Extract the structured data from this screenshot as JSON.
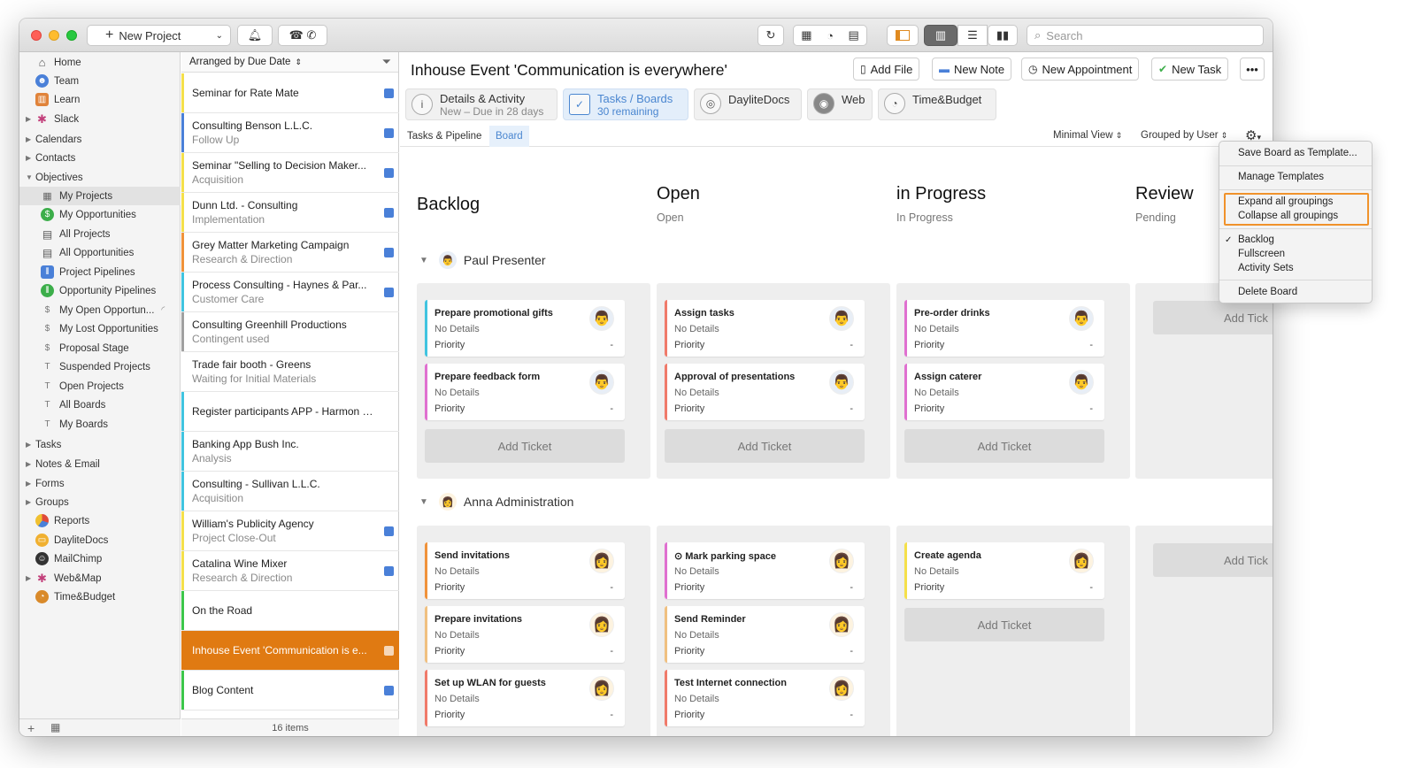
{
  "toolbar": {
    "new_project": "New Project",
    "search_placeholder": "Search"
  },
  "sidebar": {
    "items": [
      {
        "label": "Home",
        "icon": "home-icon"
      },
      {
        "label": "Team",
        "icon": "team-icon"
      },
      {
        "label": "Learn",
        "icon": "learn-icon"
      },
      {
        "label": "Slack",
        "icon": "slack-icon"
      },
      {
        "label": "Calendars"
      },
      {
        "label": "Contacts"
      },
      {
        "label": "Objectives"
      },
      {
        "label": "My Projects"
      },
      {
        "label": "My Opportunities"
      },
      {
        "label": "All Projects"
      },
      {
        "label": "All Opportunities"
      },
      {
        "label": "Project Pipelines"
      },
      {
        "label": "Opportunity Pipelines"
      },
      {
        "label": "My Open Opportun..."
      },
      {
        "label": "My Lost Opportunities"
      },
      {
        "label": "Proposal Stage"
      },
      {
        "label": "Suspended Projects"
      },
      {
        "label": "Open Projects"
      },
      {
        "label": "All Boards"
      },
      {
        "label": "My Boards"
      },
      {
        "label": "Tasks"
      },
      {
        "label": "Notes & Email"
      },
      {
        "label": "Forms"
      },
      {
        "label": "Groups"
      },
      {
        "label": "Reports"
      },
      {
        "label": "DayliteDocs"
      },
      {
        "label": "MailChimp"
      },
      {
        "label": "Web&Map"
      },
      {
        "label": "Time&Budget"
      }
    ]
  },
  "list": {
    "header": "Arranged by Due Date",
    "footer": "16 items",
    "rows": [
      {
        "title": "Seminar for Rate Mate",
        "sub": "",
        "color": "#f5e04a"
      },
      {
        "title": "Consulting Benson L.L.C.",
        "sub": "Follow Up",
        "color": "#4a80d8"
      },
      {
        "title": "Seminar \"Selling to Decision Maker...",
        "sub": "Acquisition",
        "color": "#f5e04a"
      },
      {
        "title": "Dunn Ltd. - Consulting",
        "sub": "Implementation",
        "color": "#f5e04a"
      },
      {
        "title": "Grey Matter Marketing Campaign",
        "sub": "Research & Direction",
        "color": "#f0923a"
      },
      {
        "title": "Process Consulting - Haynes & Par...",
        "sub": "Customer Care",
        "color": "#40c4e0"
      },
      {
        "title": "Consulting Greenhill Productions",
        "sub": "Contingent used",
        "color": "#a0a0a0"
      },
      {
        "title": "Trade fair booth - Greens",
        "sub": "Waiting for Initial Materials",
        "color": "#ffffff"
      },
      {
        "title": "Register participants APP - Harmon &...",
        "sub": "",
        "color": "#40c4e0"
      },
      {
        "title": "Banking App Bush Inc.",
        "sub": "Analysis",
        "color": "#40c4e0"
      },
      {
        "title": "Consulting - Sullivan L.L.C.",
        "sub": "Acquisition",
        "color": "#40c4e0"
      },
      {
        "title": "William's Publicity Agency",
        "sub": "Project Close-Out",
        "color": "#f5e04a"
      },
      {
        "title": "Catalina Wine Mixer",
        "sub": "Research & Direction",
        "color": "#f5e04a"
      },
      {
        "title": "On the Road",
        "sub": "",
        "color": "#3cc64a"
      },
      {
        "title": "Inhouse Event 'Communication is e...",
        "sub": "",
        "color": "#e07a12"
      },
      {
        "title": "Blog Content",
        "sub": "",
        "color": "#3cc64a"
      }
    ]
  },
  "main": {
    "title": "Inhouse Event 'Communication is everywhere'",
    "actions": {
      "add_file": "Add File",
      "new_note": "New Note",
      "new_appointment": "New Appointment",
      "new_task": "New Task"
    },
    "tabs": [
      {
        "l1": "Details & Activity",
        "l2": "New – Due in 28 days"
      },
      {
        "l1": "Tasks / Boards",
        "l2": "30 remaining"
      },
      {
        "l1": "DayliteDocs",
        "l2": ""
      },
      {
        "l1": "Web",
        "l2": ""
      },
      {
        "l1": "Time&Budget",
        "l2": ""
      }
    ],
    "subtabs": {
      "pipeline": "Tasks & Pipeline",
      "board": "Board"
    },
    "view": "Minimal View",
    "grouping": "Grouped by User"
  },
  "board": {
    "columns": [
      {
        "name": "Backlog",
        "sub": ""
      },
      {
        "name": "Open",
        "sub": "Open"
      },
      {
        "name": "in Progress",
        "sub": "In Progress"
      },
      {
        "name": "Review",
        "sub": "Pending"
      }
    ],
    "details": "No Details",
    "priority": "Priority",
    "dash": "-",
    "add_ticket": "Add Ticket",
    "add_ticket_cut": "Add Tick",
    "groups": [
      {
        "user": "Paul Presenter",
        "lanes": [
          [
            "Prepare promotional gifts",
            "Prepare feedback form"
          ],
          [
            "Assign tasks",
            "Approval of presentations"
          ],
          [
            "Pre-order drinks",
            "Assign caterer"
          ]
        ]
      },
      {
        "user": "Anna Administration",
        "lanes": [
          [
            "Send invitations",
            "Prepare invitations",
            "Set up WLAN for guests"
          ],
          [
            "⊙ Mark parking space",
            "Send Reminder",
            "Test Internet connection"
          ],
          [
            "Create agenda"
          ]
        ]
      }
    ]
  },
  "menu": {
    "save_template": "Save Board as Template...",
    "manage_templates": "Manage Templates",
    "expand": "Expand all groupings",
    "collapse": "Collapse all groupings",
    "backlog": "Backlog",
    "fullscreen": "Fullscreen",
    "activity_sets": "Activity Sets",
    "delete": "Delete Board"
  },
  "colors": {
    "selected_row": "#e07a12",
    "accent": "#4a86d0",
    "highlight": "#f0922b"
  }
}
